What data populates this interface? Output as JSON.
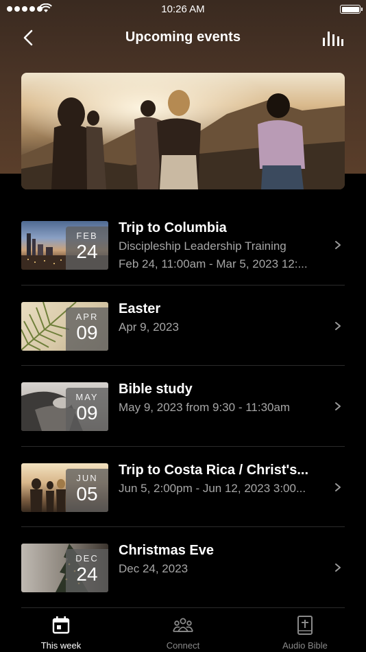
{
  "status_bar": {
    "time": "10:26 AM"
  },
  "header": {
    "title": "Upcoming events"
  },
  "events": [
    {
      "month": "FEB",
      "day": "24",
      "title": "Trip to Columbia",
      "subtitle": "Discipleship Leadership Training",
      "detail": "Feb 24, 11:00am - Mar 5, 2023 12:..."
    },
    {
      "month": "APR",
      "day": "09",
      "title": "Easter",
      "subtitle": "Apr 9, 2023"
    },
    {
      "month": "MAY",
      "day": "09",
      "title": "Bible study",
      "subtitle": "May 9, 2023 from 9:30 - 11:30am"
    },
    {
      "month": "JUN",
      "day": "05",
      "title": "Trip to Costa Rica / Christ's...",
      "subtitle": "Jun 5, 2:00pm - Jun 12, 2023 3:00..."
    },
    {
      "month": "DEC",
      "day": "24",
      "title": "Christmas Eve",
      "subtitle": "Dec 24, 2023"
    }
  ],
  "tabs": [
    {
      "label": "This week",
      "icon": "calendar-icon",
      "active": true
    },
    {
      "label": "Connect",
      "icon": "people-icon",
      "active": false
    },
    {
      "label": "Audio Bible",
      "icon": "bible-icon",
      "active": false
    }
  ]
}
